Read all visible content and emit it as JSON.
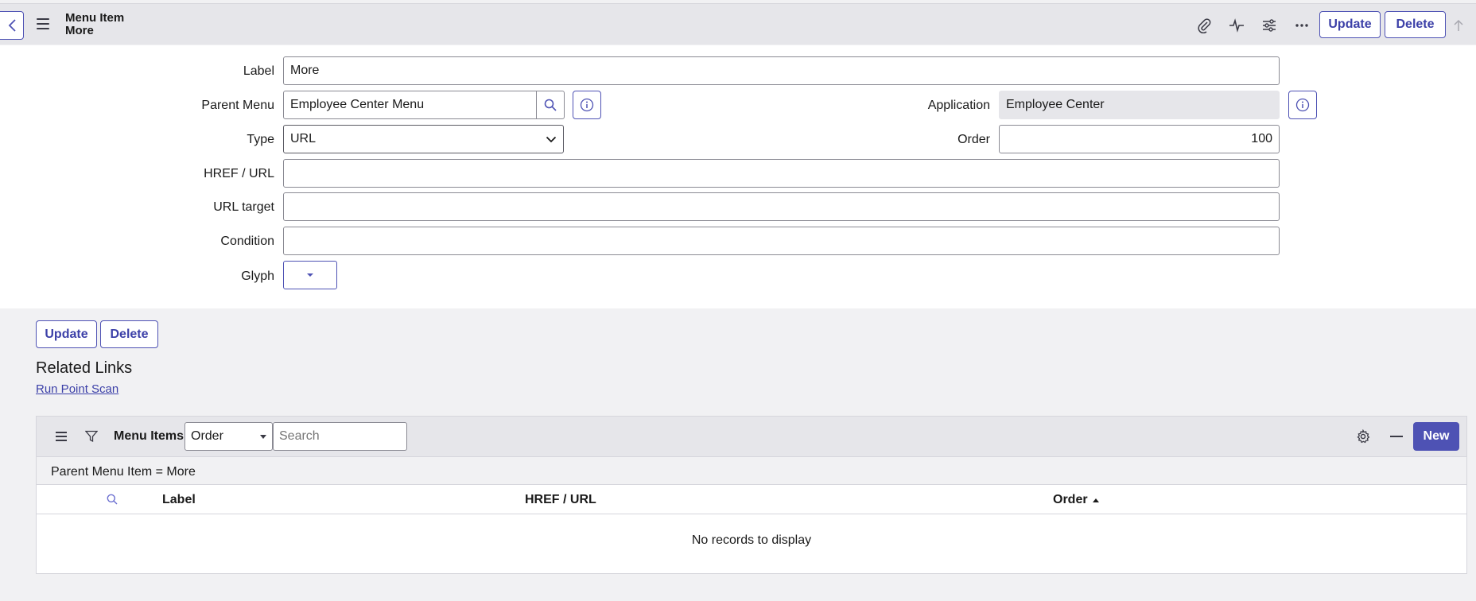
{
  "header": {
    "title_line1": "Menu Item",
    "title_line2": "More",
    "update_label": "Update",
    "delete_label": "Delete",
    "icons": [
      "paperclip-icon",
      "activity-icon",
      "sliders-icon",
      "more-icon",
      "scroll-up-icon"
    ]
  },
  "form": {
    "label": {
      "label": "Label",
      "value": "More"
    },
    "parent_menu": {
      "label": "Parent Menu",
      "value": "Employee Center Menu"
    },
    "application": {
      "label": "Application",
      "value": "Employee Center"
    },
    "type": {
      "label": "Type",
      "value": "URL"
    },
    "order": {
      "label": "Order",
      "value": "100"
    },
    "href": {
      "label": "HREF / URL",
      "value": ""
    },
    "url_target": {
      "label": "URL target",
      "value": ""
    },
    "condition": {
      "label": "Condition",
      "value": ""
    },
    "glyph": {
      "label": "Glyph"
    }
  },
  "actions": {
    "update_label": "Update",
    "delete_label": "Delete"
  },
  "related_links": {
    "title": "Related Links",
    "links": [
      "Run Point Scan"
    ]
  },
  "list": {
    "title": "Menu Items",
    "field_select": "Order",
    "search_placeholder": "Search",
    "new_label": "New",
    "filter": "Parent Menu Item = More",
    "columns": [
      "Label",
      "HREF / URL",
      "Order"
    ],
    "sort_column": "Order",
    "sort_direction": "ascending",
    "empty_message": "No records to display"
  },
  "colors": {
    "accent": "#4e52b4",
    "header_bg": "#e6e6ea",
    "page_bg": "#f1f1f3"
  }
}
